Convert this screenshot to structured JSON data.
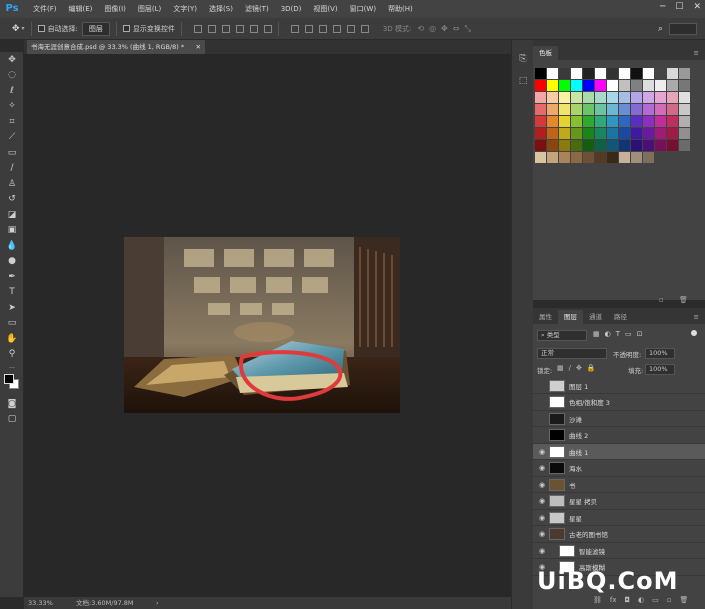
{
  "app": {
    "logo": "Ps"
  },
  "menu": [
    "文件(F)",
    "编辑(E)",
    "图像(I)",
    "图层(L)",
    "文字(Y)",
    "选择(S)",
    "滤镜(T)",
    "3D(D)",
    "视图(V)",
    "窗口(W)",
    "帮助(H)"
  ],
  "options": {
    "auto_select": "自动选择:",
    "auto_select_value": "图层",
    "show_transform": "显示变换控件",
    "mode_3d": "3D 模式:"
  },
  "document": {
    "tab_title": "书海无涯创意合成.psd @ 33.3% (曲线 1, RGB/8) *",
    "zoom": "33.33%",
    "doc_size": "文档:3.60M/97.8M"
  },
  "swatches": {
    "tab": "色板"
  },
  "layers_panel": {
    "tabs": [
      "属性",
      "图层",
      "通道",
      "路径"
    ],
    "kind_label": "类型",
    "blend_mode": "正常",
    "opacity_label": "不透明度:",
    "opacity_value": "100%",
    "lock_label": "锁定:",
    "fill_label": "填充:",
    "fill_value": "100%",
    "layers": [
      {
        "name": "图层 1",
        "visible": false,
        "selected": false
      },
      {
        "name": "色相/饱和度 3",
        "visible": false,
        "selected": false
      },
      {
        "name": "沙滩",
        "visible": false,
        "selected": false
      },
      {
        "name": "曲线 2",
        "visible": false,
        "selected": false
      },
      {
        "name": "曲线 1",
        "visible": true,
        "selected": true
      },
      {
        "name": "海水",
        "visible": true,
        "selected": false
      },
      {
        "name": "书",
        "visible": true,
        "selected": false
      },
      {
        "name": "星星 拷贝",
        "visible": true,
        "selected": false
      },
      {
        "name": "星星",
        "visible": true,
        "selected": false
      },
      {
        "name": "古老的图书馆",
        "visible": true,
        "selected": false
      },
      {
        "name": "智能滤镜",
        "visible": true,
        "selected": false
      },
      {
        "name": "高斯模糊",
        "visible": true,
        "selected": false
      }
    ]
  },
  "watermark": "UiBQ.CoM"
}
